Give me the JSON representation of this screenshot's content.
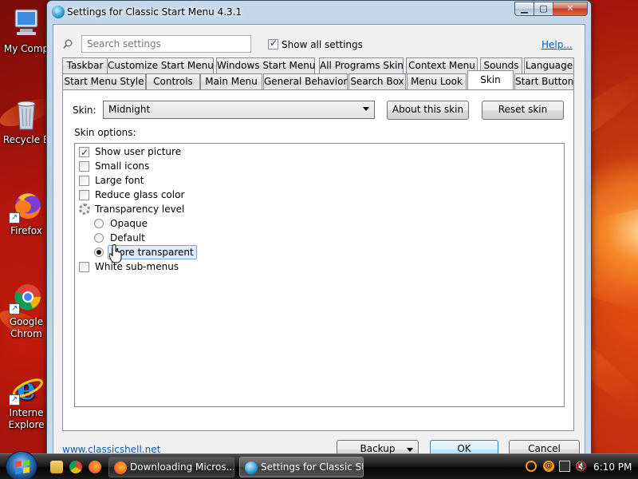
{
  "desktop": {
    "icons": [
      {
        "label": "My Comp",
        "icon": "computer-icon"
      },
      {
        "label": "Recycle B",
        "icon": "recycle-bin-icon"
      },
      {
        "label": "Firefox",
        "icon": "firefox-icon"
      },
      {
        "label": "Google\nChrom",
        "icon": "chrome-icon"
      },
      {
        "label": "Interne\nExplore",
        "icon": "internet-explorer-icon"
      }
    ]
  },
  "window": {
    "title": "Settings for Classic Start Menu 4.3.1",
    "controls": {
      "minimize": "▁",
      "maximize": "▢",
      "close": "✕"
    }
  },
  "search": {
    "placeholder": "Search settings",
    "value": ""
  },
  "show_all": {
    "label": "Show all settings",
    "checked": true
  },
  "help_link": "Help...",
  "tabs": {
    "row1": [
      "Taskbar",
      "Customize Start Menu",
      "Windows Start Menu",
      "All Programs Skin",
      "Context Menu",
      "Sounds",
      "Language"
    ],
    "row2": [
      "Start Menu Style",
      "Controls",
      "Main Menu",
      "General Behavior",
      "Search Box",
      "Menu Look",
      "Skin",
      "Start Button"
    ],
    "active": "Skin"
  },
  "skin_page": {
    "skin_label": "Skin:",
    "skin_value": "Midnight",
    "about_button": "About this skin",
    "reset_button": "Reset skin",
    "options_label": "Skin options:",
    "options": [
      {
        "label": "Show user picture",
        "kind": "checkbox",
        "checked": true
      },
      {
        "label": "Small icons",
        "kind": "checkbox",
        "checked": false
      },
      {
        "label": "Large font",
        "kind": "checkbox",
        "checked": false
      },
      {
        "label": "Reduce glass color",
        "kind": "checkbox",
        "checked": false
      },
      {
        "label": "Transparency level",
        "kind": "group",
        "icon": "gear-icon"
      },
      {
        "label": "Opaque",
        "kind": "radio",
        "checked": false
      },
      {
        "label": "Default",
        "kind": "radio",
        "checked": false
      },
      {
        "label": "More transparent",
        "kind": "radio",
        "checked": true,
        "selected": true
      },
      {
        "label": "White sub-menus",
        "kind": "checkbox",
        "checked": false
      }
    ]
  },
  "footer": {
    "site_link": "www.classicshell.net",
    "backup_button": "Backup",
    "ok_button": "OK",
    "cancel_button": "Cancel"
  },
  "taskbar": {
    "tasks": [
      {
        "label": "Downloading Micros...",
        "icon": "firefox-icon",
        "active": false
      },
      {
        "label": "Settings for Classic St...",
        "icon": "classic-shell-icon",
        "active": true
      }
    ],
    "clock": "6:10 PM"
  },
  "colors": {
    "accent": "#0b57c2",
    "wallpaper": "#a8140c",
    "window_frame": "#c5d7eb"
  }
}
